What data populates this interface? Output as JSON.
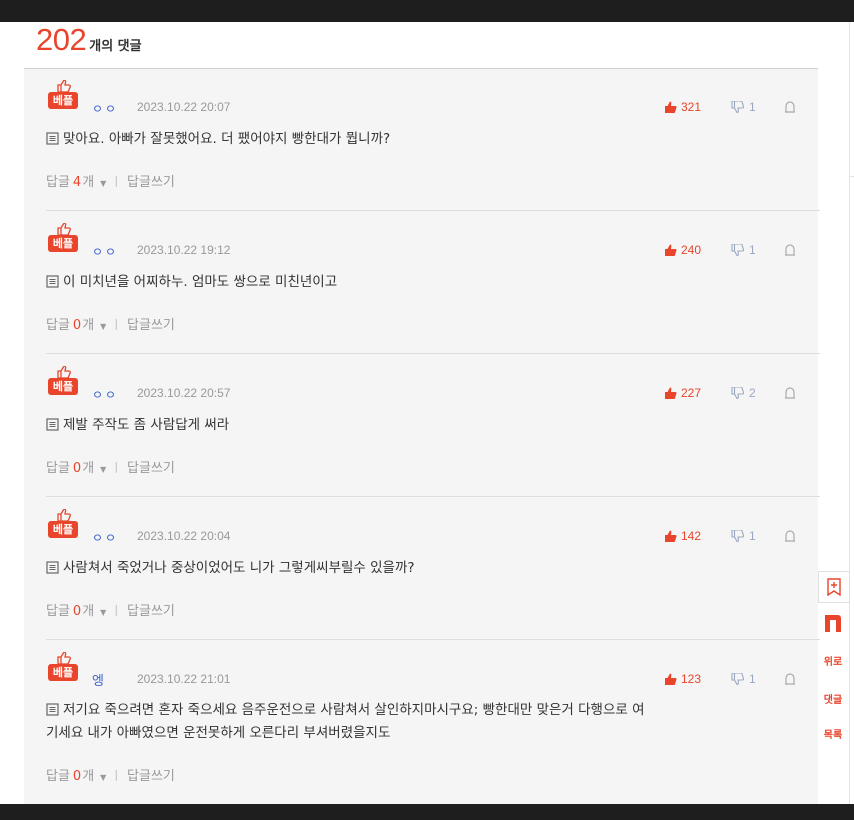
{
  "header": {
    "count": "202",
    "count_label": "개의 댓글"
  },
  "badge_label": "베플",
  "reply": {
    "label": "답글",
    "unit": "개",
    "write_label": "답글쓰기"
  },
  "comments": [
    {
      "author": "ㅇㅇ",
      "date": "2023.10.22 20:07",
      "likes": "321",
      "dislikes": "1",
      "lines": [
        "맞아요. 아빠가 잘못했어요. 더 팼어야지 빵한대가 뭡니까?"
      ],
      "reply_count": "4"
    },
    {
      "author": "ㅇㅇ",
      "date": "2023.10.22 19:12",
      "likes": "240",
      "dislikes": "1",
      "lines": [
        "이 미치년을 어찌하누. 엄마도 쌍으로 미친년이고"
      ],
      "reply_count": "0"
    },
    {
      "author": "ㅇㅇ",
      "date": "2023.10.22 20:57",
      "likes": "227",
      "dislikes": "2",
      "lines": [
        "제발 주작도 좀 사람답게 써라"
      ],
      "reply_count": "0"
    },
    {
      "author": "ㅇㅇ",
      "date": "2023.10.22 20:04",
      "likes": "142",
      "dislikes": "1",
      "lines": [
        "사람쳐서 죽었거나 중상이었어도 니가 그렇게씨부릴수 있을까?"
      ],
      "reply_count": "0"
    },
    {
      "author": "엥",
      "date": "2023.10.22 21:01",
      "likes": "123",
      "dislikes": "1",
      "lines": [
        "저기요 죽으려면 혼자 죽으세요 음주운전으로 사람쳐서 살인하지마시구요; 빵한대만 맞은거 다행으로 여",
        "기세요 내가 아빠였으면 운전못하게 오른다리 부셔버렸을지도"
      ],
      "reply_count": "0"
    }
  ],
  "side_buttons": {
    "top": "위로",
    "comments": "댓글",
    "list": "목록"
  },
  "colors": {
    "accent": "#e8452c",
    "author": "#3a64c8",
    "muted": "#999999"
  },
  "icons": [
    "thumbs-up-icon",
    "thumbs-down-icon",
    "report-icon",
    "memo-icon",
    "bookmark-icon",
    "n-logo-icon"
  ]
}
